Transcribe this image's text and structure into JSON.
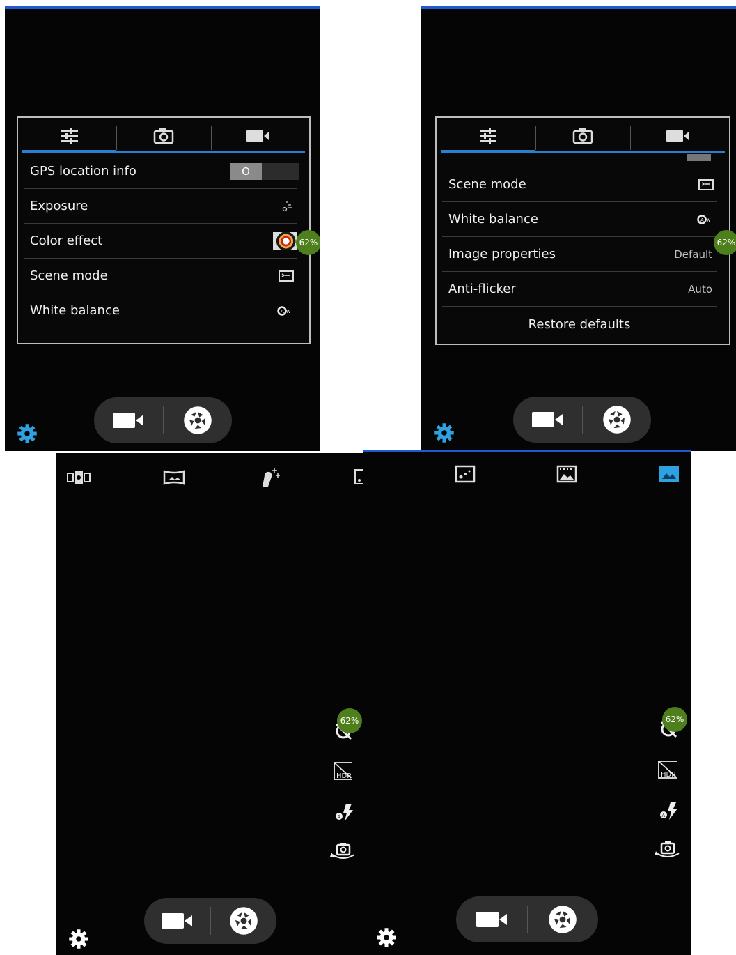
{
  "colors": {
    "accent": "#2a7fd0",
    "badge": "#4e7f1c",
    "highlight": "#2fa0e0"
  },
  "battery_badge": "62%",
  "tabs": [
    "settings-sliders-icon",
    "camera-icon",
    "video-camera-icon"
  ],
  "screen1": {
    "rows": [
      {
        "label": "GPS location info",
        "control": "toggle",
        "toggle_text": "O"
      },
      {
        "label": "Exposure",
        "icon": "exposure-icon"
      },
      {
        "label": "Color effect",
        "icon": "color-effect-thumbnail"
      },
      {
        "label": "Scene mode",
        "icon": "scene-mode-icon"
      },
      {
        "label": "White balance",
        "icon": "auto-white-balance-icon"
      }
    ]
  },
  "screen2": {
    "rows": [
      {
        "label": "Scene mode",
        "icon": "scene-mode-icon"
      },
      {
        "label": "White balance",
        "icon": "auto-white-balance-icon"
      },
      {
        "label": "Image properties",
        "value": "Default"
      },
      {
        "label": "Anti-flicker",
        "value": "Auto"
      }
    ],
    "restore_label": "Restore defaults"
  },
  "screen3": {
    "modes": [
      "multi-angle-view-icon",
      "panorama-icon",
      "face-beauty-icon",
      "live-photo-icon"
    ],
    "side_controls": [
      "timer-off-icon",
      "hdr-off-icon",
      "flash-auto-icon",
      "switch-camera-icon"
    ]
  },
  "screen4": {
    "modes": [
      "motion-track-icon",
      "smile-shot-icon",
      "normal-photo-icon"
    ],
    "active_mode": "normal-photo-icon",
    "side_controls": [
      "timer-off-icon",
      "hdr-off-icon",
      "flash-auto-icon",
      "switch-camera-icon"
    ]
  },
  "controls": [
    "video-record-button",
    "shutter-button",
    "settings-gear-icon"
  ]
}
